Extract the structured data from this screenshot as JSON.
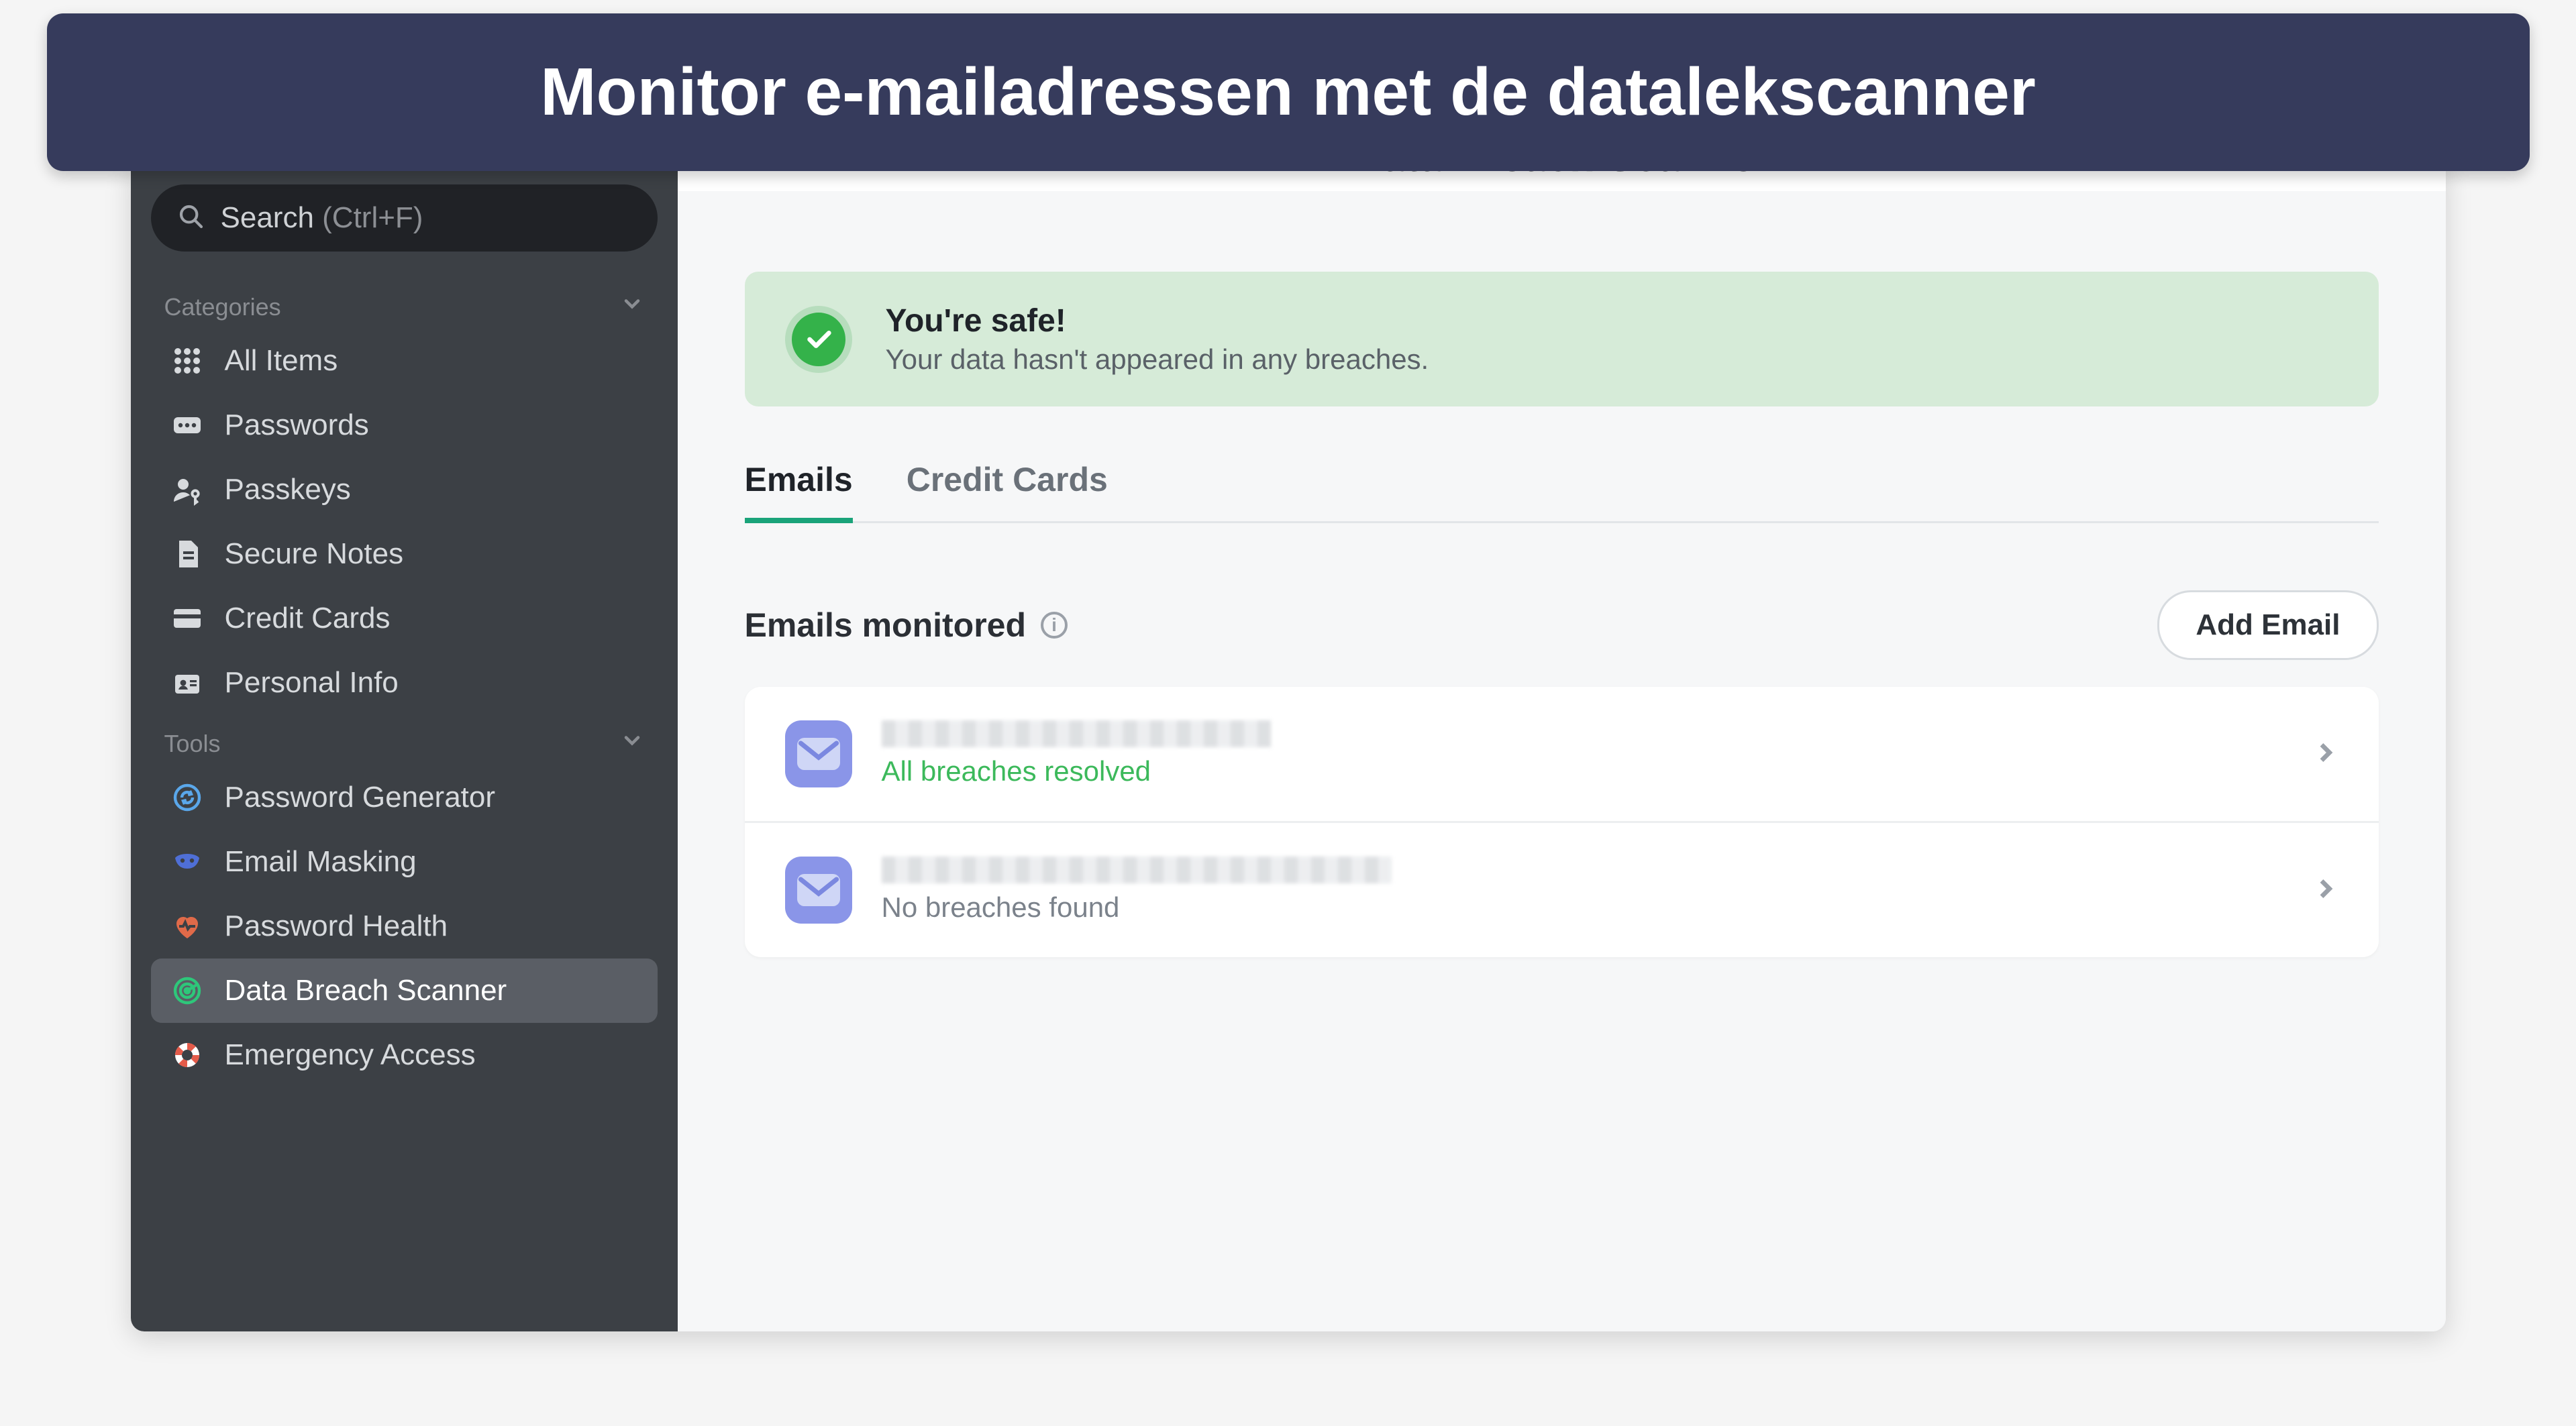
{
  "banner": {
    "text": "Monitor e-mailadressen met de datalekscanner"
  },
  "sidebar": {
    "search": {
      "label": "Search",
      "hint": "(Ctrl+F)"
    },
    "sections": {
      "categories": {
        "label": "Categories"
      },
      "tools": {
        "label": "Tools"
      }
    },
    "categories": [
      {
        "label": "All Items"
      },
      {
        "label": "Passwords"
      },
      {
        "label": "Passkeys"
      },
      {
        "label": "Secure Notes"
      },
      {
        "label": "Credit Cards"
      },
      {
        "label": "Personal Info"
      }
    ],
    "tools": [
      {
        "label": "Password Generator"
      },
      {
        "label": "Email Masking"
      },
      {
        "label": "Password Health"
      },
      {
        "label": "Data Breach Scanner"
      },
      {
        "label": "Emergency Access"
      }
    ]
  },
  "main": {
    "page_title": "Data Breach Scanner",
    "alert": {
      "title": "You're safe!",
      "subtitle": "Your data hasn't appeared in any breaches."
    },
    "tabs": [
      {
        "label": "Emails",
        "active": true
      },
      {
        "label": "Credit Cards",
        "active": false
      }
    ],
    "list_header": "Emails monitored",
    "add_button": "Add Email",
    "emails": [
      {
        "status": "All breaches resolved",
        "status_kind": "ok"
      },
      {
        "status": "No breaches found",
        "status_kind": "none"
      }
    ]
  }
}
